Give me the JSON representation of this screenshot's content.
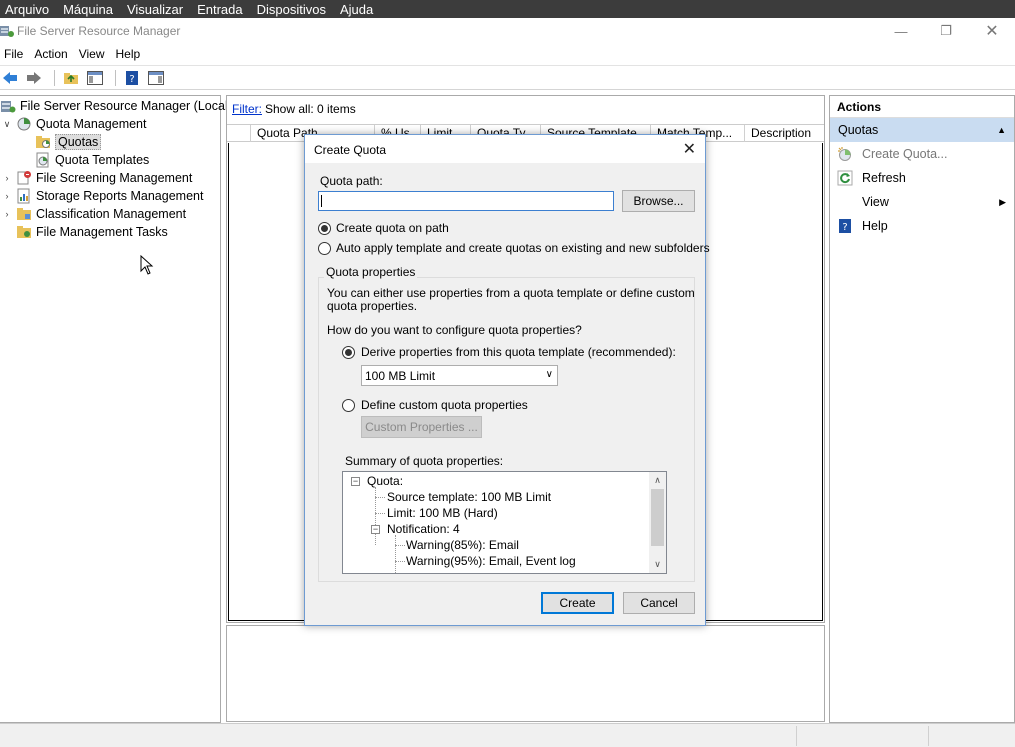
{
  "vm_menu": [
    "Arquivo",
    "Máquina",
    "Visualizar",
    "Entrada",
    "Dispositivos",
    "Ajuda"
  ],
  "window": {
    "title": "File Server Resource Manager"
  },
  "menubar": [
    "File",
    "Action",
    "View",
    "Help"
  ],
  "tree": {
    "root": "File Server Resource Manager (Local)",
    "quota_management": "Quota Management",
    "quotas": "Quotas",
    "quota_templates": "Quota Templates",
    "file_screening": "File Screening Management",
    "storage_reports": "Storage Reports Management",
    "classification": "Classification Management",
    "file_management": "File Management Tasks"
  },
  "center": {
    "filter_link": "Filter:",
    "filter_text": "Show all: 0 items",
    "columns": [
      "Quota Path",
      "% Us...",
      "Limit",
      "Quota Ty...",
      "Source Template",
      "Match Temp...",
      "Description"
    ]
  },
  "actions": {
    "title": "Actions",
    "section": "Quotas",
    "items": [
      "Create Quota...",
      "Refresh",
      "View",
      "Help"
    ]
  },
  "dialog": {
    "title": "Create Quota",
    "quota_path_label": "Quota path:",
    "quota_path_value": "",
    "browse_label": "Browse...",
    "radio_create_on_path": "Create quota on path",
    "radio_auto_apply": "Auto apply template and create quotas on existing and new subfolders",
    "group_title": "Quota properties",
    "group_desc_1": "You can either use properties from a quota template or define custom",
    "group_desc_2": "quota properties.",
    "how_question": "How do you want to configure quota properties?",
    "radio_derive": "Derive properties from this quota template (recommended):",
    "template_selected": "100 MB Limit",
    "radio_custom": "Define custom quota properties",
    "custom_button": "Custom Properties ...",
    "summary_label": "Summary of quota properties:",
    "summary": {
      "quota": "Quota:",
      "source": "Source template: 100 MB Limit",
      "limit": "Limit: 100 MB (Hard)",
      "notification": "Notification: 4",
      "warn85": "Warning(85%): Email",
      "warn95": "Warning(95%): Email, Event log"
    },
    "create_label": "Create",
    "cancel_label": "Cancel"
  },
  "colors": {
    "accent": "#0078d7",
    "section_bg": "#c9dcf1",
    "vm_bar": "#3c3c3c"
  }
}
